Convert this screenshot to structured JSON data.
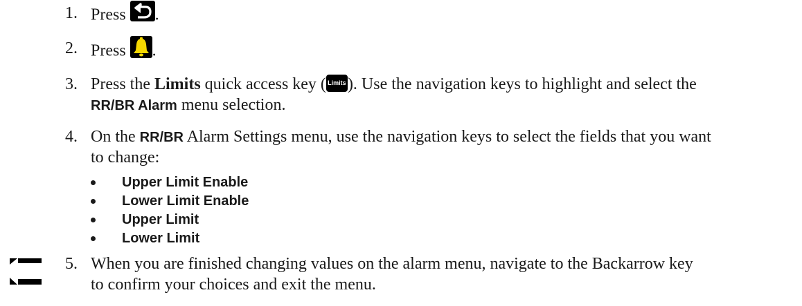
{
  "steps": [
    {
      "num": "1.",
      "prefix": "Press ",
      "suffix": ".",
      "icon": "back-arrow-icon"
    },
    {
      "num": "2.",
      "prefix": "Press ",
      "suffix": ".",
      "icon": "alarm-bell-icon"
    },
    {
      "num": "3.",
      "a": "Press the ",
      "b": "Limits",
      "c": " quick access key (",
      "key": "Limits",
      "d": "). Use the navigation keys to highlight and select the",
      "e": "RR/BR Alarm",
      "f": " menu selection."
    },
    {
      "num": "4.",
      "a": "On the ",
      "b": "RR/BR",
      "c": " Alarm Settings menu, use the navigation keys to select the fields that you want",
      "d": "to change:"
    },
    {
      "num": "5.",
      "a": "When you are finished changing values on the alarm menu, navigate to the Backarrow key",
      "b": "to confirm your choices and exit the menu."
    }
  ],
  "fields": [
    "Upper Limit Enable",
    "Lower Limit Enable",
    "Upper Limit",
    "Lower Limit"
  ],
  "colors": {
    "bell": "#f5d800",
    "key_bg": "#000000"
  }
}
